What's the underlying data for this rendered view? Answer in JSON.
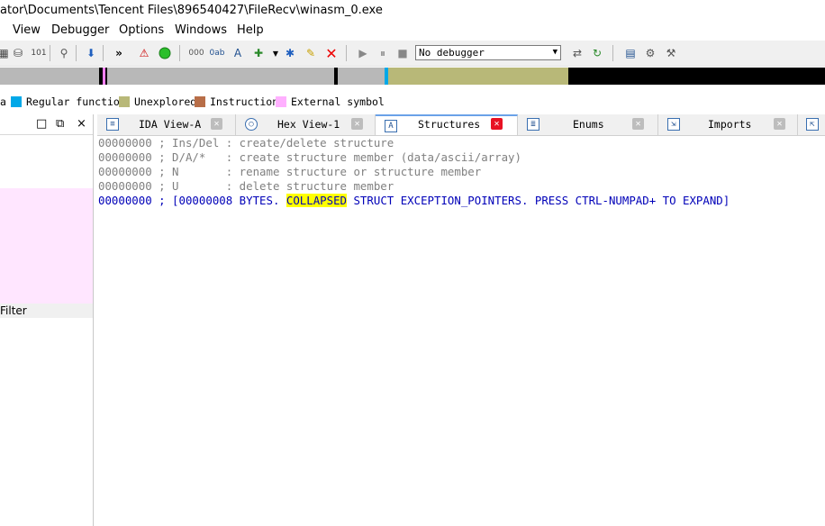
{
  "window": {
    "title": "ator\\Documents\\Tencent Files\\896540427\\FileRecv\\winasm_0.exe"
  },
  "menu": [
    "View",
    "Debugger",
    "Options",
    "Windows",
    "Help"
  ],
  "toolbar": {
    "debugger_select": "No debugger",
    "icons": [
      "hex-view-icon",
      "bookmark-icon",
      "binary-icon",
      "find-icon",
      "jump-down-icon",
      "more-icon",
      "warning-icon",
      "run-green-icon",
      "struct-icon",
      "enum-icon",
      "string-icon",
      "create-icon",
      "cross-icon",
      "edit-icon",
      "delete-icon",
      "play-icon",
      "pause-icon",
      "stop-icon",
      "attach-icon",
      "reload-icon",
      "graph-icon",
      "tree-icon",
      "tree-x-icon"
    ]
  },
  "legend": [
    {
      "label": "a",
      "color": ""
    },
    {
      "label": "Regular function",
      "color": "#00a8e8"
    },
    {
      "label": "Unexplored",
      "color": "#b8b878"
    },
    {
      "label": "Instruction",
      "color": "#b86e48"
    },
    {
      "label": "External symbol",
      "color": "#ffb0ff"
    }
  ],
  "left_panel": {
    "filter_label": "Filter",
    "buttons": [
      "□",
      "⧉",
      "×"
    ]
  },
  "tabs": [
    {
      "label": "IDA View-A",
      "icon": "ida-view-icon",
      "active": false
    },
    {
      "label": "Hex View-1",
      "icon": "hex-view-icon",
      "active": false
    },
    {
      "label": "Structures",
      "icon": "structures-icon",
      "active": true
    },
    {
      "label": "Enums",
      "icon": "enums-icon",
      "active": false
    },
    {
      "label": "Imports",
      "icon": "imports-icon",
      "active": false
    }
  ],
  "code": {
    "lines": [
      "00000000 ; Ins/Del : create/delete structure",
      "00000000 ; D/A/*   : create structure member (data/ascii/array)",
      "00000000 ; N       : rename structure or structure member",
      "00000000 ; U       : delete structure member"
    ],
    "highlight_pre": "00000000 ; [00000008 BYTES. ",
    "highlight_mark": "COLLAPSED",
    "highlight_post": " STRUCT EXCEPTION_POINTERS. PRESS CTRL-NUMPAD+ TO EXPAND]"
  }
}
